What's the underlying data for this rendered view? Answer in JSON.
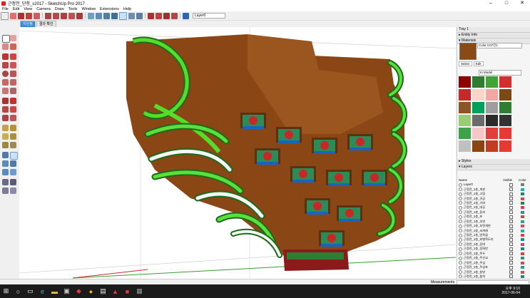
{
  "window": {
    "title": "근정전_단청_s2017 - SketchUp Pro 2017"
  },
  "menu": [
    "File",
    "Edit",
    "View",
    "Camera",
    "Draw",
    "Tools",
    "Window",
    "Extensions",
    "Help"
  ],
  "toolbar": {
    "layer_value": "Layer0"
  },
  "scenes": [
    "지단청",
    "결과 확인"
  ],
  "tray": {
    "title": "Tray 1",
    "entity_info": "Entity Info",
    "materials": "Materials",
    "material_name": "Color C07인1",
    "tab_select": "Select",
    "tab_edit": "Edit",
    "library": "In Model",
    "styles": "Styles",
    "layers_section": "Layers",
    "columns": {
      "name": "Name",
      "visible": "Visible",
      "color": "Color"
    },
    "swatch_colors": [
      "#8b0000",
      "#2e7d32",
      "#3fa335",
      "#d32f2f",
      "#c62828",
      "#fbd5c7",
      "#f4a7a0",
      "#7b4a12",
      "#8d5524",
      "#00a05a",
      "#9e9e9e",
      "#2e7d32",
      "#9acd72",
      "#6b6b6b",
      "#2b2b2b",
      "#333333",
      "#3ea24a",
      "#f7c6c6",
      "#e23d3d",
      "#e53935",
      "#c0c0c0",
      "#8b4513",
      "#c23b22",
      "#e53935"
    ],
    "layers": [
      {
        "name": "Layer0",
        "color": "#7a7a7a"
      },
      {
        "name": "근정전_1층_개판",
        "color": "#2ba9a5"
      },
      {
        "name": "근정전_1층_고림",
        "color": "#1d7f7a"
      },
      {
        "name": "근정전_1층_귀공",
        "color": "#d14b4b"
      },
      {
        "name": "근정전_1층_기와",
        "color": "#2a7f55"
      },
      {
        "name": "근정전_1층_대공",
        "color": "#c7455f"
      },
      {
        "name": "근정전_1층_동자",
        "color": "#2f8f80"
      },
      {
        "name": "근정전_1층_보",
        "color": "#c94b4b"
      },
      {
        "name": "근정전_1층_부연",
        "color": "#3a9b86"
      },
      {
        "name": "근정전_1층_부연개판",
        "color": "#d44b6a"
      },
      {
        "name": "근정전_1층_서까래",
        "color": "#2aa9a0"
      },
      {
        "name": "근정전_1층_연목골",
        "color": "#d6464a"
      },
      {
        "name": "근정전_1층_외벌목도리",
        "color": "#2a8a83"
      },
      {
        "name": "근정전_1층_장여",
        "color": "#c9476c"
      },
      {
        "name": "근정전_1층_장화반",
        "color": "#178b7b"
      },
      {
        "name": "근정전_1층_주두",
        "color": "#cc4545"
      },
      {
        "name": "근정전_1층_주선교",
        "color": "#2f8f86"
      },
      {
        "name": "근정전_1층_주심",
        "color": "#c74b5a"
      },
      {
        "name": "근정전_1층_주심포",
        "color": "#2a9d8f"
      },
      {
        "name": "근정전_1층_창방",
        "color": "#d3504d"
      },
      {
        "name": "근정전_1층_첨차",
        "color": "#238a7c"
      },
      {
        "name": "근정전_1층_추녀",
        "color": "#c44b61"
      },
      {
        "name": "근정전_1층_평방",
        "color": "#2a8d7f"
      },
      {
        "name": "근정전_1층_한대",
        "color": "#d14848"
      }
    ]
  },
  "status": {
    "measurements": "Measurements"
  },
  "taskbar": {
    "time": "오후 9:10",
    "date": "2017-06-04"
  }
}
